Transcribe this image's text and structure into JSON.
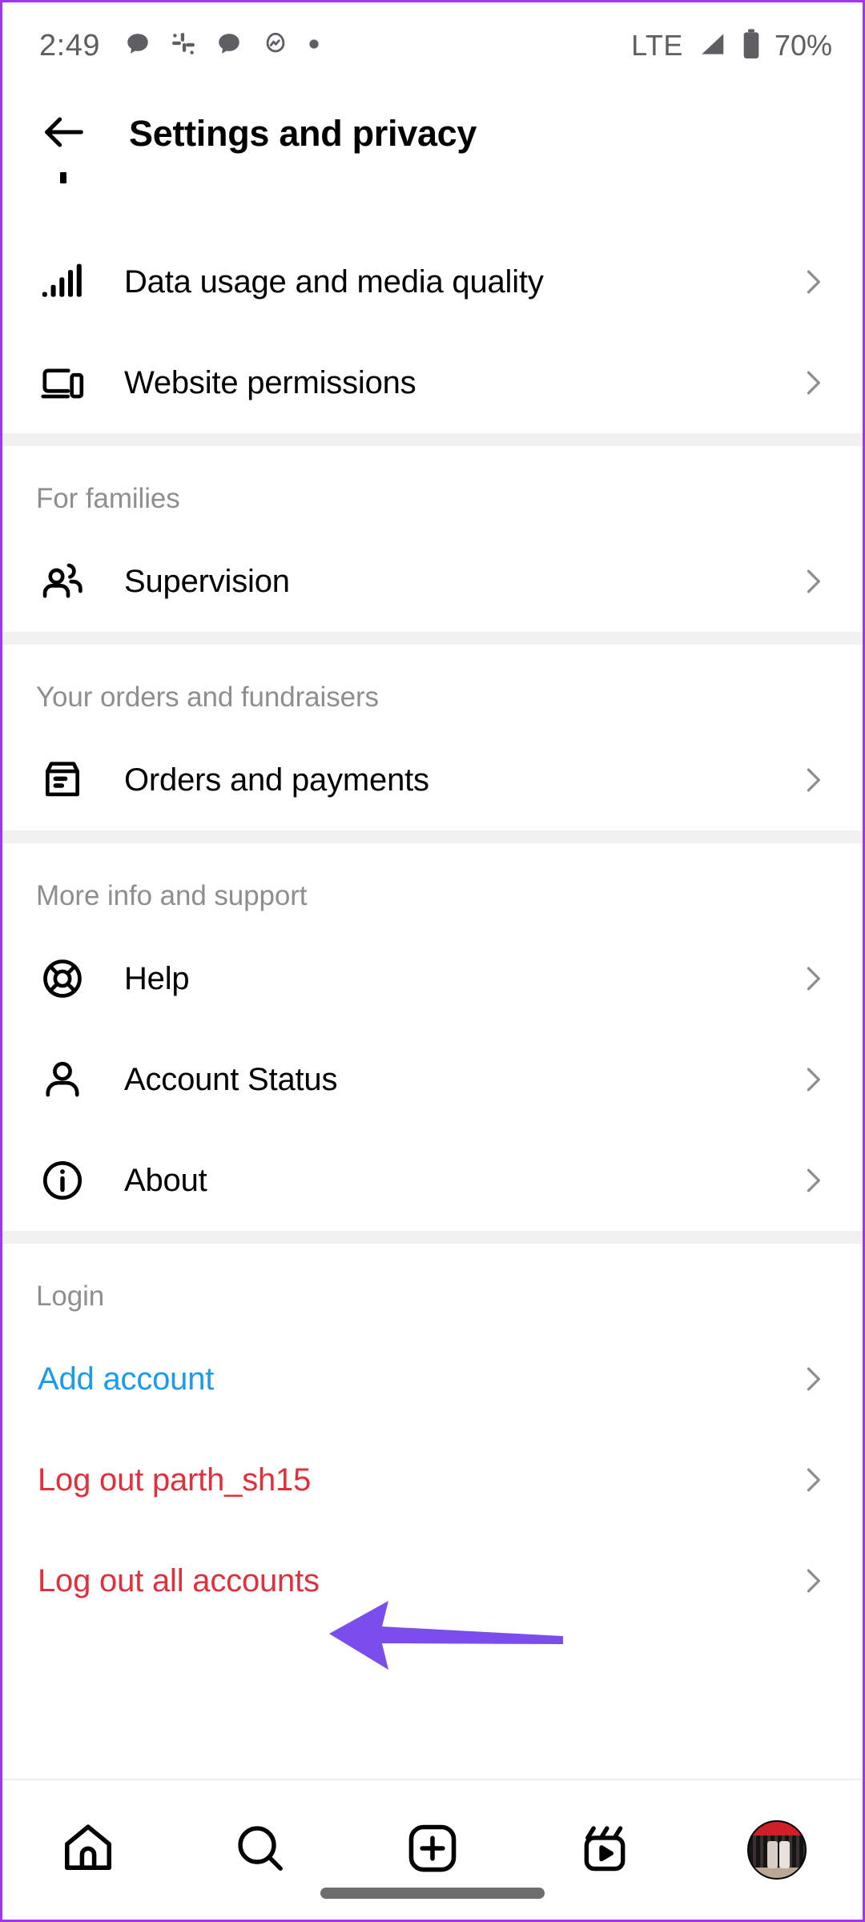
{
  "status_bar": {
    "time": "2:49",
    "network": "LTE",
    "battery_percent": "70%",
    "left_icons": [
      "chat-bubble-icon",
      "slack-icon",
      "chat-bubble-icon",
      "activity-egg-icon",
      "dot-icon"
    ],
    "right_icons": [
      "signal-icon",
      "battery-icon"
    ]
  },
  "header": {
    "back_icon": "back-arrow-icon",
    "title": "Settings and privacy"
  },
  "colors": {
    "link_blue": "#1a9bf0",
    "danger_red": "#e0303c",
    "section_label_gray": "#8e8e8e",
    "chevron_gray": "#8e8e8e",
    "divider_gray": "#f1f1f1",
    "annotation_purple": "#7c4ded"
  },
  "sections": [
    {
      "heading": "",
      "items": [
        {
          "label": "Data usage and media quality",
          "icon": "signal-bars-icon",
          "color": "default"
        },
        {
          "label": "Website permissions",
          "icon": "devices-icon",
          "color": "default"
        }
      ]
    },
    {
      "heading": "For families",
      "items": [
        {
          "label": "Supervision",
          "icon": "people-icon",
          "color": "default"
        }
      ]
    },
    {
      "heading": "Your orders and fundraisers",
      "items": [
        {
          "label": "Orders and payments",
          "icon": "receipt-box-icon",
          "color": "default"
        }
      ]
    },
    {
      "heading": "More info and support",
      "items": [
        {
          "label": "Help",
          "icon": "life-ring-icon",
          "color": "default"
        },
        {
          "label": "Account Status",
          "icon": "person-icon",
          "color": "default"
        },
        {
          "label": "About",
          "icon": "info-circle-icon",
          "color": "default"
        }
      ]
    },
    {
      "heading": "Login",
      "items": [
        {
          "label": "Add account",
          "icon": "",
          "color": "blue"
        },
        {
          "label": "Log out parth_sh15",
          "icon": "",
          "color": "red"
        },
        {
          "label": "Log out all accounts",
          "icon": "",
          "color": "red"
        }
      ]
    }
  ],
  "annotation": {
    "type": "arrow",
    "direction": "left",
    "points_at": "Log out parth_sh15"
  },
  "bottom_nav": {
    "items": [
      {
        "name": "home-icon",
        "label": "Home"
      },
      {
        "name": "search-icon",
        "label": "Search"
      },
      {
        "name": "create-icon",
        "label": "Create"
      },
      {
        "name": "reels-icon",
        "label": "Reels"
      },
      {
        "name": "profile-avatar",
        "label": "Profile"
      }
    ]
  }
}
